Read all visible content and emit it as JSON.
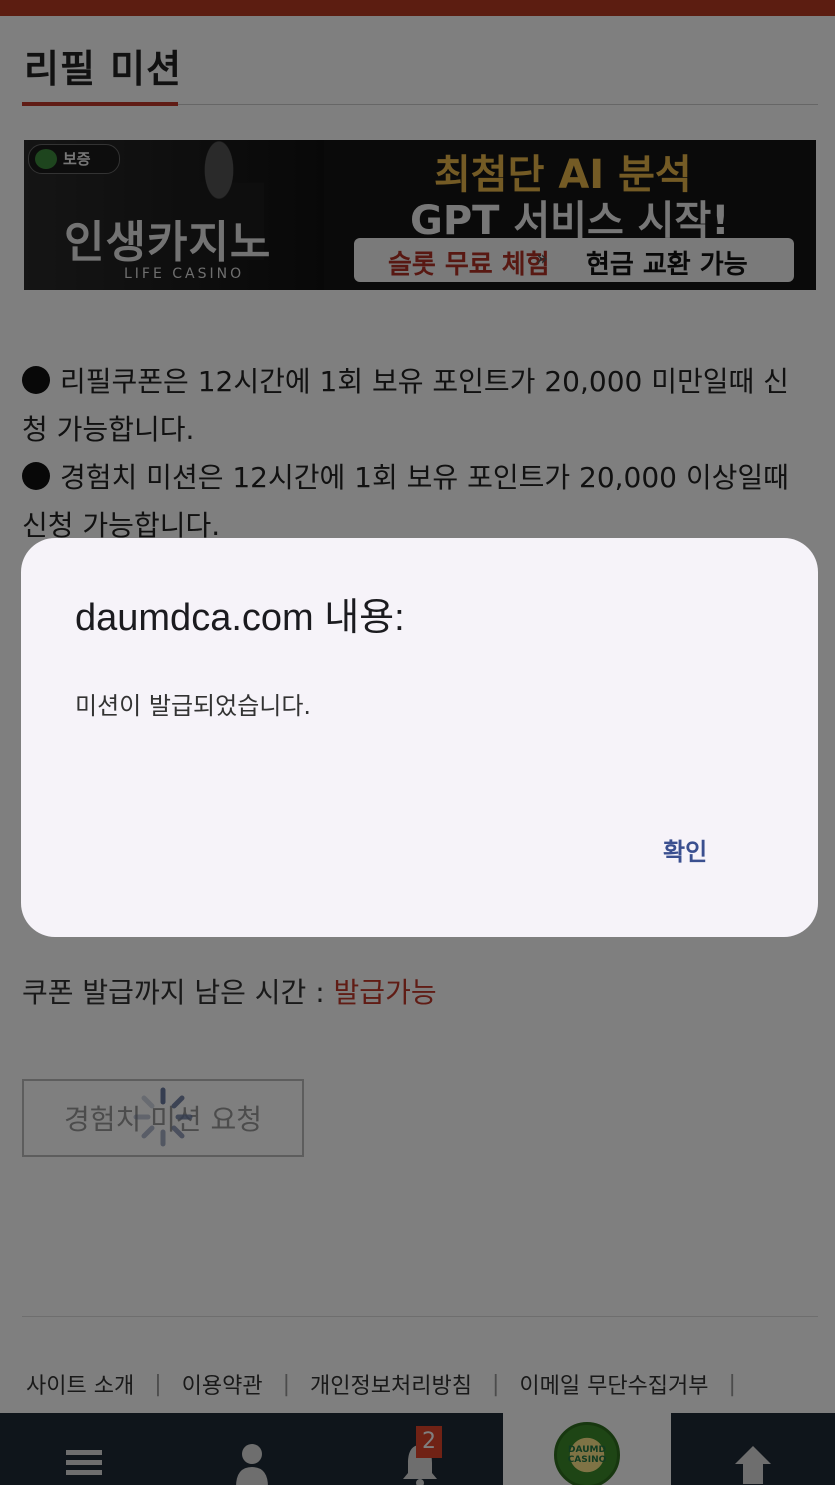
{
  "page": {
    "title": "리필 미션"
  },
  "banner": {
    "badge": "보증",
    "logo": "인생카지노",
    "sublogo": "LIFE CASINO",
    "headline1": "최첨단 AI 분석",
    "headline2": "GPT 서비스 시작!",
    "pill_left": "슬롯 무료 체험",
    "pill_sep": "»",
    "pill_right": "현금 교환 가능"
  },
  "notices": {
    "refill": "리필쿠폰은 12시간에 1회 보유 포인트가 20,000 미만일때 신청 가능합니다.",
    "experience": "경험치 미션은 12시간에 1회 보유 포인트가 20,000 이상일때 신청 가능합니다."
  },
  "coupon": {
    "label": "쿠폰 발급까지 남은 시간 : ",
    "status": "발급가능"
  },
  "mission_button": {
    "label": "경험치 미션 요청"
  },
  "footer": {
    "links": [
      "사이트 소개",
      "이용약관",
      "개인정보처리방침",
      "이메일 무단수집거부"
    ]
  },
  "bottom_nav": {
    "notification_count": "2",
    "home_logo": "DAUMD CASINO"
  },
  "dialog": {
    "title": "daumdca.com 내용:",
    "message": "미션이 발급되었습니다.",
    "ok_label": "확인"
  },
  "colors": {
    "accent": "#c0392b",
    "top_bar": "#b83a22",
    "nav_bg": "#1e2a36",
    "dialog_button": "#3a4f8f"
  }
}
